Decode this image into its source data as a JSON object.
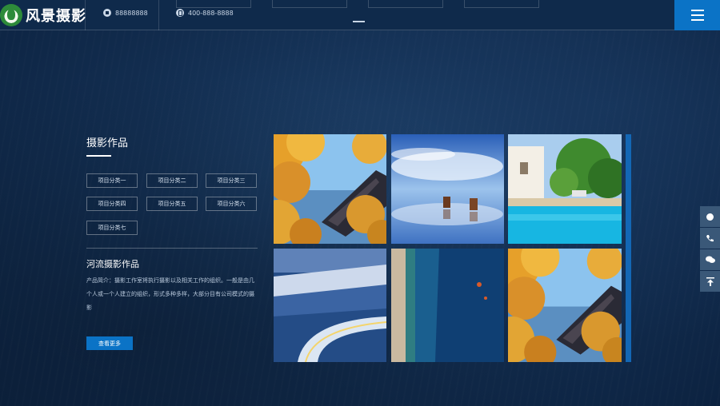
{
  "header": {
    "logo_text": "风景摄影",
    "contact_home": "88888888",
    "contact_phone": "400-888-8888"
  },
  "works": {
    "title": "摄影作品",
    "categories": [
      "项目分类一",
      "项目分类二",
      "项目分类三",
      "项目分类四",
      "项目分类五",
      "项目分类六",
      "项目分类七"
    ]
  },
  "intro": {
    "title": "河流摄影作品",
    "description": "产品简介：摄影工作室将执行摄影以及相关工作的组织。一般是由几个人或一个人建立的组织，形式多种多样，大部分目有公司模式的摄影",
    "more_label": "查看更多"
  },
  "gallery": {
    "images": [
      "autumn-temple",
      "horses-reflection",
      "villa-pool",
      "coastal-town-night",
      "aerial-breakwater",
      "autumn-temple"
    ]
  },
  "floating_buttons": [
    "qq-icon",
    "phone-icon",
    "wechat-icon",
    "back-to-top-icon"
  ],
  "colors": {
    "accent": "#0b73c6",
    "background": "#132f52"
  }
}
